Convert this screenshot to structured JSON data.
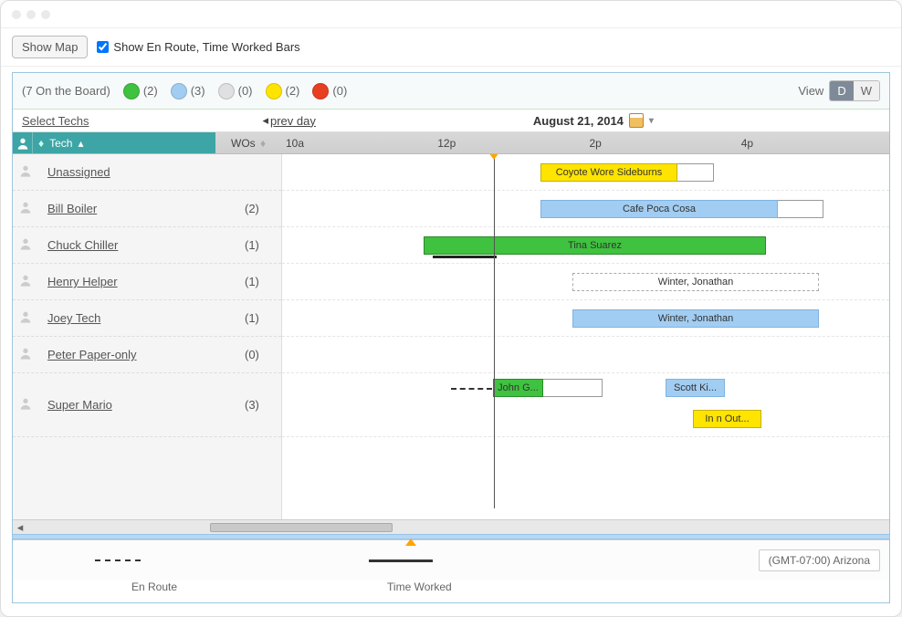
{
  "toolbar": {
    "show_map_label": "Show Map",
    "checkbox_label": "Show En Route, Time Worked Bars",
    "checkbox_checked": true
  },
  "legend": {
    "board_count_text": "(7 On the Board)",
    "statuses": [
      {
        "color": "#3fc23f",
        "count": "(2)"
      },
      {
        "color": "#a2cdf2",
        "count": "(3)"
      },
      {
        "color": "#e0e0e0",
        "count": "(0)"
      },
      {
        "color": "#ffe400",
        "count": "(2)"
      },
      {
        "color": "#e74020",
        "count": "(0)"
      }
    ],
    "view_label": "View",
    "view_d": "D",
    "view_w": "W"
  },
  "nav": {
    "select_techs": "Select Techs",
    "prev_day": "prev day",
    "date": "August 21, 2014"
  },
  "columns": {
    "tech": "Tech",
    "wos": "WOs",
    "hours": [
      "10a",
      "12p",
      "2p",
      "4p"
    ]
  },
  "techs": [
    {
      "name": "Unassigned",
      "wos": "",
      "tall": false
    },
    {
      "name": "Bill Boiler",
      "wos": "(2)",
      "tall": false
    },
    {
      "name": "Chuck Chiller",
      "wos": "(1)",
      "tall": false
    },
    {
      "name": "Henry Helper",
      "wos": "(1)",
      "tall": false
    },
    {
      "name": "Joey Tech",
      "wos": "(1)",
      "tall": false
    },
    {
      "name": "Peter Paper-only",
      "wos": "(0)",
      "tall": false
    },
    {
      "name": "Super Mario",
      "wos": "(3)",
      "tall": true
    }
  ],
  "bars": {
    "coyote": "Coyote Wore Sideburns",
    "cafe": "Cafe Poca Cosa",
    "tina": "Tina Suarez",
    "winter_dashed": "Winter, Jonathan",
    "winter_blue": "Winter, Jonathan",
    "john": "John G...",
    "scott": "Scott Ki...",
    "innout": "In n Out..."
  },
  "footer": {
    "en_route": "En Route",
    "time_worked": "Time Worked",
    "timezone": "(GMT-07:00) Arizona"
  }
}
